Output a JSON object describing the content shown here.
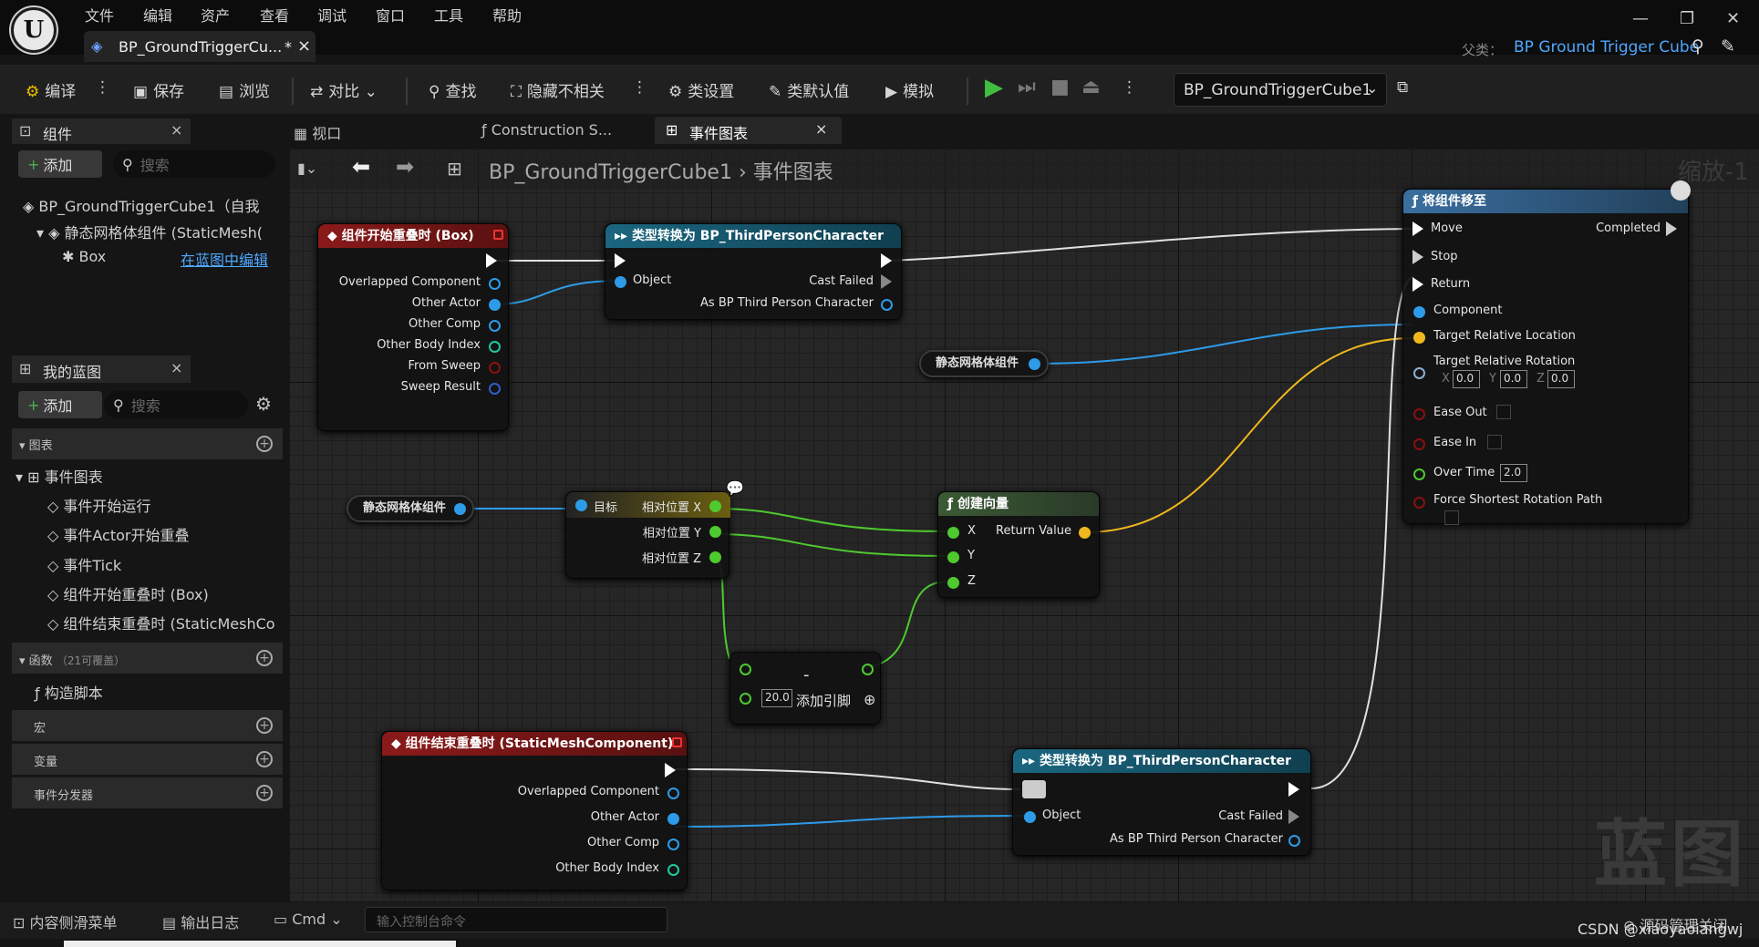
{
  "menu": [
    "文件",
    "编辑",
    "资产",
    "查看",
    "调试",
    "窗口",
    "工具",
    "帮助"
  ],
  "doc_tab": {
    "title": "BP_GroundTriggerCu...",
    "modified": "*",
    "close": "×"
  },
  "parent": {
    "label": "父类：",
    "value": "BP Ground Trigger Cube"
  },
  "window_controls": {
    "min": "—",
    "restore": "❐",
    "close": "✕"
  },
  "toolbar": {
    "compile": "编译",
    "save": "保存",
    "browse": "浏览",
    "diff": "对比",
    "find": "查找",
    "hide": "隐藏不相关",
    "class_settings": "类设置",
    "class_defaults": "类默认值",
    "simulate": "模拟",
    "debug_object": "BP_GroundTriggerCube1"
  },
  "components": {
    "title": "组件",
    "add": "添加",
    "search": "搜索",
    "root": "BP_GroundTriggerCube1（自我",
    "child": "静态网格体组件 (StaticMesh(",
    "box": "Box",
    "edit_link": "在蓝图中编辑"
  },
  "my_blueprint": {
    "title": "我的蓝图",
    "add": "添加",
    "search": "搜索",
    "graphs": "图表",
    "event_graph": "事件图表",
    "events": [
      "事件开始运行",
      "事件Actor开始重叠",
      "事件Tick",
      "组件开始重叠时 (Box)",
      "组件结束重叠时 (StaticMeshCo"
    ],
    "functions": "函数",
    "functions_note": "（21可覆盖）",
    "construction": "构造脚本",
    "macros": "宏",
    "variables": "变量",
    "dispatchers": "事件分发器"
  },
  "graph_tabs": {
    "viewport": "视口",
    "construction": "Construction S...",
    "event_graph": "事件图表"
  },
  "breadcrumb": {
    "bp": "BP_GroundTriggerCube1",
    "sep": "›",
    "graph": "事件图表"
  },
  "zoom": "缩放-1",
  "watermark": "蓝图",
  "nodes": {
    "begin_overlap": {
      "title": "组件开始重叠时 (Box)",
      "pins": [
        "Overlapped Component",
        "Other Actor",
        "Other Comp",
        "Other Body Index",
        "From Sweep",
        "Sweep Result"
      ]
    },
    "cast1": {
      "title": "类型转换为 BP_ThirdPersonCharacter",
      "object": "Object",
      "cast_failed": "Cast Failed",
      "as": "As BP Third Person Character"
    },
    "mesh_var1": {
      "label": "静态网格体组件"
    },
    "mesh_var2": {
      "label": "静态网格体组件"
    },
    "rel_loc": {
      "target": "目标",
      "x": "相对位置 X",
      "y": "相对位置 Y",
      "z": "相对位置 Z"
    },
    "make_vector": {
      "title": "创建向量",
      "x": "X",
      "y": "Y",
      "z": "Z",
      "ret": "Return Value"
    },
    "minus": {
      "op": "-",
      "value": "20.0",
      "add_pin": "添加引脚"
    },
    "move_to": {
      "title": "将组件移至",
      "move": "Move",
      "stop": "Stop",
      "return": "Return",
      "completed": "Completed",
      "component": "Component",
      "target_loc": "Target Relative Location",
      "target_rot": "Target Relative Rotation",
      "rx": "0.0",
      "ry": "0.0",
      "rz": "0.0",
      "ease_out": "Ease Out",
      "ease_in": "Ease In",
      "over_time": "Over Time",
      "over_time_val": "2.0",
      "force": "Force Shortest Rotation Path"
    },
    "end_overlap": {
      "title": "组件结束重叠时 (StaticMeshComponent)",
      "pins": [
        "Overlapped Component",
        "Other Actor",
        "Other Comp",
        "Other Body Index"
      ]
    },
    "cast2": {
      "title": "类型转换为 BP_ThirdPersonCharacter",
      "object": "Object",
      "cast_failed": "Cast Failed",
      "as": "As BP Third Person Character"
    }
  },
  "bottom": {
    "content_drawer": "内容侧滑菜单",
    "output_log": "输出日志",
    "cmd": "Cmd",
    "console_placeholder": "输入控制台命令",
    "source_control": "源码管理关闭",
    "credit": "CSDN @xiaoyaoiangwj"
  }
}
